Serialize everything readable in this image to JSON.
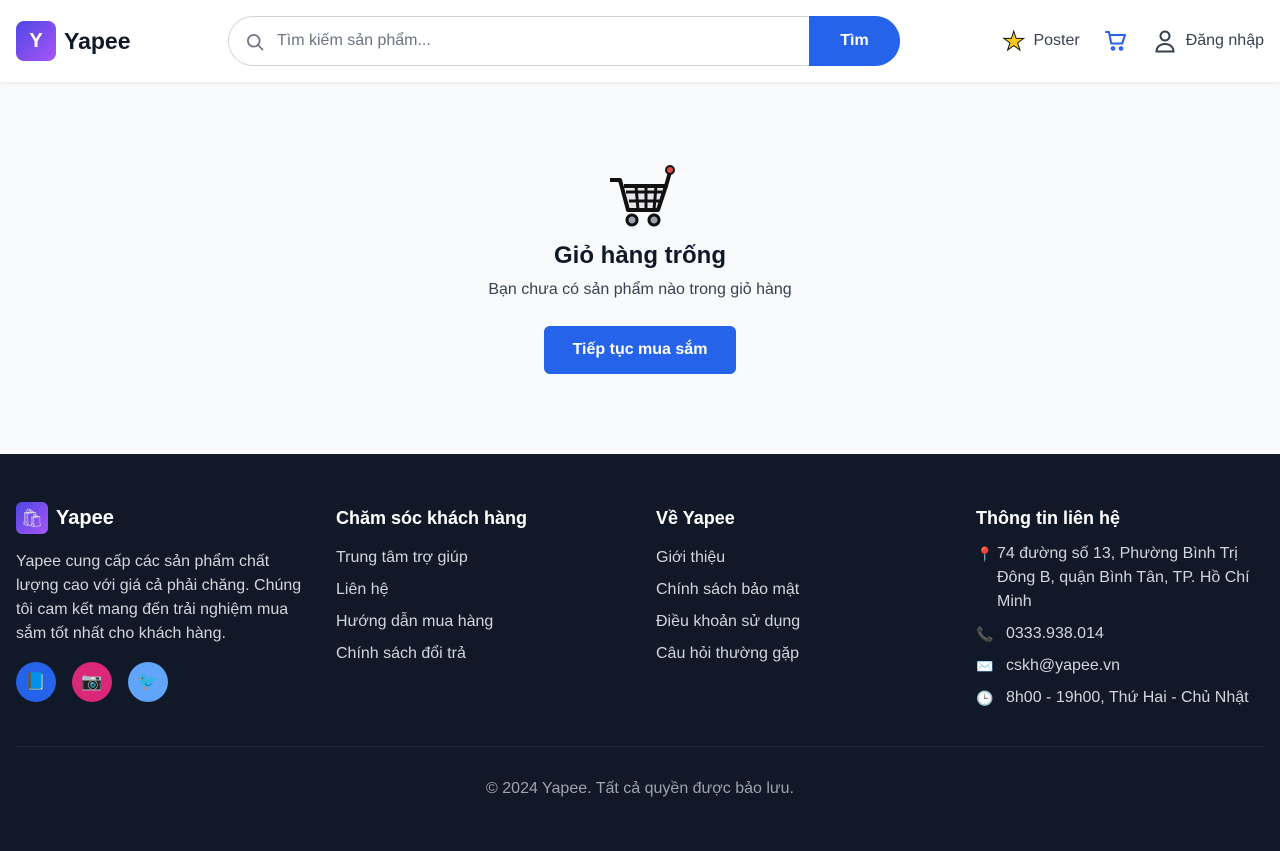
{
  "header": {
    "logo_letter": "Y",
    "brand": "Yapee",
    "search": {
      "placeholder": "Tìm kiếm sản phẩm...",
      "button_label": "Tìm"
    },
    "nav": {
      "poster_label": "Poster",
      "login_label": "Đăng nhập"
    }
  },
  "empty_cart": {
    "title": "Giỏ hàng trống",
    "subtitle": "Bạn chưa có sản phẩm nào trong giỏ hàng",
    "button_label": "Tiếp tục mua sắm"
  },
  "footer": {
    "brand": "Yapee",
    "description": "Yapee cung cấp các sản phẩm chất lượng cao với giá cả phải chăng. Chúng tôi cam kết mang đến trải nghiệm mua sắm tốt nhất cho khách hàng.",
    "socials": [
      "facebook",
      "instagram",
      "twitter"
    ],
    "customer_care": {
      "heading": "Chăm sóc khách hàng",
      "links": [
        "Trung tâm trợ giúp",
        "Liên hệ",
        "Hướng dẫn mua hàng",
        "Chính sách đổi trả"
      ]
    },
    "about": {
      "heading": "Về Yapee",
      "links": [
        "Giới thiệu",
        "Chính sách bảo mật",
        "Điều khoản sử dụng",
        "Câu hỏi thường gặp"
      ]
    },
    "contact": {
      "heading": "Thông tin liên hệ",
      "address": "74 đường số 13, Phường Bình Trị Đông B, quận Bình Tân, TP. Hồ Chí Minh",
      "phone": "0333.938.014",
      "email": "cskh@yapee.vn",
      "hours": "8h00 - 19h00, Thứ Hai - Chủ Nhật"
    },
    "copyright": "© 2024 Yapee. Tất cả quyền được bảo lưu."
  },
  "colors": {
    "primary": "#2563eb",
    "footer_bg": "#111827",
    "page_bg": "#f8fafc",
    "brand_gradient_start": "#4f46e5",
    "brand_gradient_end": "#a855f7"
  },
  "icons": {
    "search": "search-icon",
    "poster": "star-icon",
    "cart": "cart-icon",
    "user": "user-icon",
    "empty_cart": "shopping-cart-icon"
  }
}
